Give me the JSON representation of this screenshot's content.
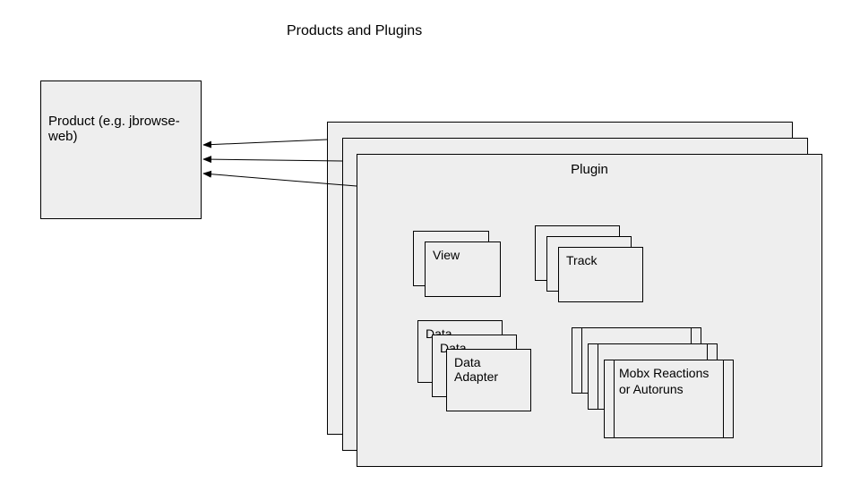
{
  "title": "Products and Plugins",
  "product": {
    "label": "Product (e.g. jbrowse-web)"
  },
  "plugin": {
    "title": "Plugin",
    "components": {
      "view": "View",
      "track": "Track",
      "data_adapter_short": "Data",
      "data_adapter": "Data Adapter",
      "mobx": "Mobx Reactions or Autoruns"
    }
  },
  "arrows": [
    {
      "from": "plugin-stack-back",
      "to": "product-box"
    },
    {
      "from": "plugin-stack-mid",
      "to": "product-box"
    },
    {
      "from": "plugin-stack-front",
      "to": "product-box"
    }
  ]
}
